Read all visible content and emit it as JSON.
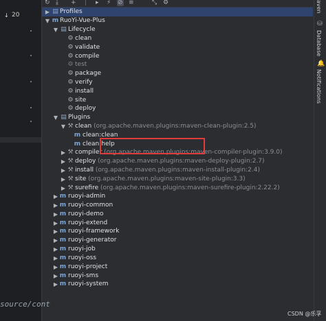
{
  "editor": {
    "gutter_number": "20",
    "code_snippet": "source/cont"
  },
  "toolbar": {
    "buttons": [
      {
        "icon": "refresh-icon"
      },
      {
        "icon": "download-icon"
      },
      {
        "icon": "add-icon"
      },
      {
        "icon": "run-icon"
      },
      {
        "icon": "toggle-offline-icon"
      },
      {
        "icon": "skip-tests-icon"
      },
      {
        "icon": "show-dependencies-icon"
      },
      {
        "icon": "collapse-all-icon"
      },
      {
        "icon": "settings-icon"
      }
    ]
  },
  "tree": {
    "profiles": "Profiles",
    "project": "RuoYi-Vue-Plus",
    "lifecycle": {
      "label": "Lifecycle",
      "items": [
        "clean",
        "validate",
        "compile",
        "test",
        "package",
        "verify",
        "install",
        "site",
        "deploy"
      ]
    },
    "plugins": {
      "label": "Plugins",
      "items": [
        {
          "name": "clean",
          "coord": "(org.apache.maven.plugins:maven-clean-plugin:2.5)",
          "expanded": true,
          "goals": [
            "clean:clean",
            "clean:help"
          ]
        },
        {
          "name": "compiler",
          "coord": "(org.apache.maven.plugins:maven-compiler-plugin:3.9.0)"
        },
        {
          "name": "deploy",
          "coord": "(org.apache.maven.plugins:maven-deploy-plugin:2.7)"
        },
        {
          "name": "install",
          "coord": "(org.apache.maven.plugins:maven-install-plugin:2.4)"
        },
        {
          "name": "site",
          "coord": "(org.apache.maven.plugins:maven-site-plugin:3.3)"
        },
        {
          "name": "surefire",
          "coord": "(org.apache.maven.plugins:maven-surefire-plugin:2.22.2)"
        }
      ]
    },
    "modules": [
      "ruoyi-admin",
      "ruoyi-common",
      "ruoyi-demo",
      "ruoyi-extend",
      "ruoyi-framework",
      "ruoyi-generator",
      "ruoyi-job",
      "ruoyi-oss",
      "ruoyi-project",
      "ruoyi-sms",
      "ruoyi-system"
    ]
  },
  "sidebar": {
    "maven_tab": "aven",
    "database_tab": "Database",
    "notifications_tab": "Notifications"
  },
  "watermark": "CSDN @乐孚"
}
